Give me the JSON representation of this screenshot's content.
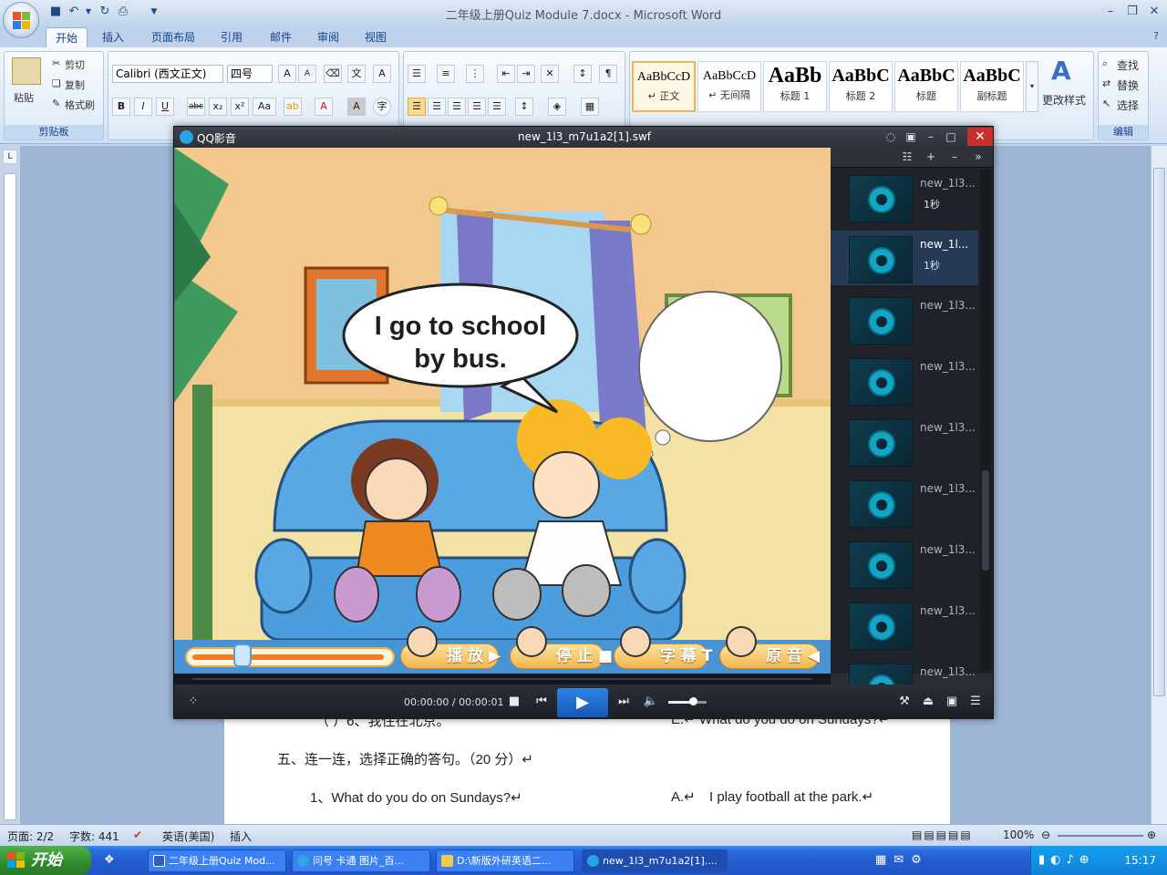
{
  "word": {
    "title": "二年级上册Quiz Module 7.docx - Microsoft Word",
    "tabs": [
      "开始",
      "插入",
      "页面布局",
      "引用",
      "邮件",
      "审阅",
      "视图"
    ],
    "active_tab": "开始",
    "clipboard": {
      "paste": "粘贴",
      "cut": "剪切",
      "copy": "复制",
      "format_painter": "格式刷",
      "group": "剪贴板"
    },
    "font": {
      "name": "Calibri (西文正文)",
      "size": "四号"
    },
    "styles": [
      {
        "sample": "AaBbCcD",
        "name": "↵ 正文"
      },
      {
        "sample": "AaBbCcD",
        "name": "↵ 无间隔"
      },
      {
        "sample": "AaBb",
        "name": "标题 1"
      },
      {
        "sample": "AaBbC",
        "name": "标题 2"
      },
      {
        "sample": "AaBbC",
        "name": "标题"
      },
      {
        "sample": "AaBbC",
        "name": "副标题"
      }
    ],
    "change_styles": "更改样式",
    "editing": {
      "find": "查找",
      "replace": "替换",
      "select": "选择",
      "group": "编辑"
    },
    "document": {
      "line1_left": "（    ）6、我住在北京。",
      "line1_right": "E.↵  What do you do on Sundays?↵",
      "heading": "五、连一连，选择正确的答句。（20 分）↵",
      "q1": "1、What do you do on Sundays?↵",
      "a1_label": "A.↵",
      "a1": "I play football at the park.↵"
    },
    "status": {
      "page": "页面: 2/2",
      "words": "字数: 441",
      "language": "英语(美国)",
      "mode": "插入",
      "zoom": "100%"
    }
  },
  "player": {
    "app_name": "QQ影音",
    "file_name": "new_1l3_m7u1a2[1].swf",
    "time": "00:00:00 / 00:00:01",
    "volume_level": 0.65,
    "progress": 0,
    "speech_line1": "I go to school",
    "speech_line2": "by bus.",
    "flash_progress": 0.26,
    "flash_buttons": [
      "播 放",
      "停 止",
      "字 幕",
      "原 音"
    ],
    "playlist": [
      {
        "name": "new_1l3...",
        "duration": "1秒",
        "selected": false
      },
      {
        "name": "new_1l...",
        "duration": "1秒",
        "selected": true
      },
      {
        "name": "new_1l3...",
        "duration": "",
        "selected": false
      },
      {
        "name": "new_1l3...",
        "duration": "",
        "selected": false
      },
      {
        "name": "new_1l3...",
        "duration": "",
        "selected": false
      },
      {
        "name": "new_1l3...",
        "duration": "",
        "selected": false
      },
      {
        "name": "new_1l3...",
        "duration": "",
        "selected": false
      },
      {
        "name": "new_1l3...",
        "duration": "",
        "selected": false
      },
      {
        "name": "new_1l3...",
        "duration": "",
        "selected": false
      }
    ]
  },
  "taskbar": {
    "start": "开始",
    "tasks": [
      "二年级上册Quiz Mod...",
      "问号 卡通 图片_百...",
      "D:\\新版外研英语二...",
      "new_1l3_m7u1a2[1]...."
    ],
    "active_task": 3,
    "clock": "15:17"
  },
  "colors": {
    "ribbon_blue": "#15428b",
    "player_dark": "#2a2d33",
    "play_blue": "#2f83e5",
    "taskbar": "#245dd1",
    "start_green": "#2f8a2c"
  }
}
